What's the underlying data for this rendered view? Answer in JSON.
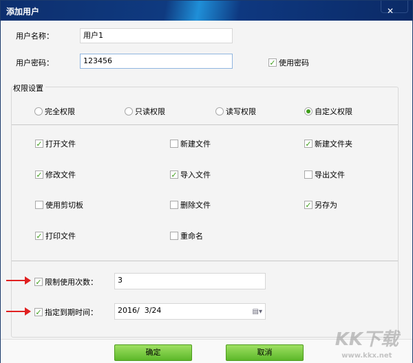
{
  "window": {
    "title": "添加用户",
    "close_icon": "close-icon"
  },
  "form": {
    "username_label": "用户名称：",
    "username_value": "用户1",
    "password_label": "用户密码：",
    "password_value": "123456",
    "use_password_label": "使用密码",
    "use_password_checked": true
  },
  "permissions": {
    "group_title": "权限设置",
    "radios": [
      {
        "label": "完全权限",
        "selected": false
      },
      {
        "label": "只读权限",
        "selected": false
      },
      {
        "label": "读写权限",
        "selected": false
      },
      {
        "label": "自定义权限",
        "selected": true
      }
    ],
    "checks": [
      {
        "label": "打开文件",
        "checked": true
      },
      {
        "label": "新建文件",
        "checked": false
      },
      {
        "label": "新建文件夹",
        "checked": true
      },
      {
        "label": "修改文件",
        "checked": true
      },
      {
        "label": "导入文件",
        "checked": true
      },
      {
        "label": "导出文件",
        "checked": false
      },
      {
        "label": "使用剪切板",
        "checked": false
      },
      {
        "label": "删除文件",
        "checked": false
      },
      {
        "label": "另存为",
        "checked": true
      },
      {
        "label": "打印文件",
        "checked": true
      },
      {
        "label": "重命名",
        "checked": false
      }
    ]
  },
  "limits": {
    "count_label": "限制使用次数：",
    "count_checked": true,
    "count_value": "3",
    "expire_label": "指定到期时间：",
    "expire_checked": true,
    "expire_value": "2016/  3/24"
  },
  "buttons": {
    "ok": "确定",
    "cancel": "取消"
  },
  "watermark": {
    "logo": "KK下载",
    "url": "www.kkx.net"
  },
  "colors": {
    "accent": "#3f9d1a",
    "title_bar": "#0f3a80",
    "arrow": "#e02020"
  }
}
